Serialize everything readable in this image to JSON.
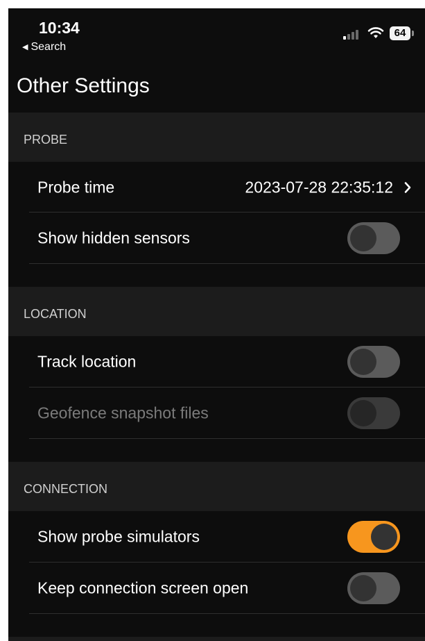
{
  "status_bar": {
    "time": "10:34",
    "back_label": "Search",
    "battery": "64"
  },
  "page_title": "Other Settings",
  "sections": {
    "probe": {
      "header": "PROBE",
      "probe_time_label": "Probe time",
      "probe_time_value": "2023-07-28 22:35:12",
      "show_hidden_label": "Show hidden sensors",
      "show_hidden_on": false
    },
    "location": {
      "header": "LOCATION",
      "track_label": "Track location",
      "track_on": false,
      "geofence_label": "Geofence snapshot files",
      "geofence_on": false,
      "geofence_enabled": false
    },
    "connection": {
      "header": "CONNECTION",
      "simulators_label": "Show probe simulators",
      "simulators_on": true,
      "keep_open_label": "Keep connection screen open",
      "keep_open_on": false
    }
  },
  "colors": {
    "accent": "#f7961e",
    "background": "#0d0d0d",
    "section_header": "#1c1c1c"
  }
}
